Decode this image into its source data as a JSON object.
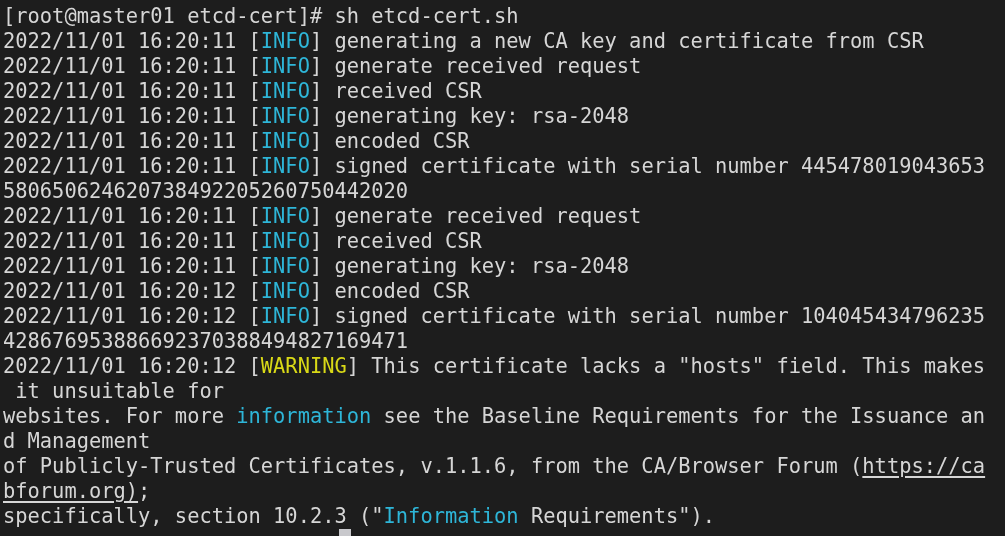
{
  "terminal": {
    "lines": [
      [
        {
          "kind": "text",
          "text": "[root@master01 etcd-cert]# sh etcd-cert.sh"
        }
      ],
      [
        {
          "kind": "text",
          "text": "2022/11/01 16:20:11 ["
        },
        {
          "kind": "info",
          "text": "INFO"
        },
        {
          "kind": "text",
          "text": "] generating a new CA key and certificate from CSR"
        }
      ],
      [
        {
          "kind": "text",
          "text": "2022/11/01 16:20:11 ["
        },
        {
          "kind": "info",
          "text": "INFO"
        },
        {
          "kind": "text",
          "text": "] generate received request"
        }
      ],
      [
        {
          "kind": "text",
          "text": "2022/11/01 16:20:11 ["
        },
        {
          "kind": "info",
          "text": "INFO"
        },
        {
          "kind": "text",
          "text": "] received CSR"
        }
      ],
      [
        {
          "kind": "text",
          "text": "2022/11/01 16:20:11 ["
        },
        {
          "kind": "info",
          "text": "INFO"
        },
        {
          "kind": "text",
          "text": "] generating key: rsa-2048"
        }
      ],
      [
        {
          "kind": "text",
          "text": "2022/11/01 16:20:11 ["
        },
        {
          "kind": "info",
          "text": "INFO"
        },
        {
          "kind": "text",
          "text": "] encoded CSR"
        }
      ],
      [
        {
          "kind": "text",
          "text": "2022/11/01 16:20:11 ["
        },
        {
          "kind": "info",
          "text": "INFO"
        },
        {
          "kind": "text",
          "text": "] signed certificate with serial number 445478019043653"
        }
      ],
      [
        {
          "kind": "text",
          "text": "580650624620738492205260750442020"
        }
      ],
      [
        {
          "kind": "text",
          "text": "2022/11/01 16:20:11 ["
        },
        {
          "kind": "info",
          "text": "INFO"
        },
        {
          "kind": "text",
          "text": "] generate received request"
        }
      ],
      [
        {
          "kind": "text",
          "text": "2022/11/01 16:20:11 ["
        },
        {
          "kind": "info",
          "text": "INFO"
        },
        {
          "kind": "text",
          "text": "] received CSR"
        }
      ],
      [
        {
          "kind": "text",
          "text": "2022/11/01 16:20:11 ["
        },
        {
          "kind": "info",
          "text": "INFO"
        },
        {
          "kind": "text",
          "text": "] generating key: rsa-2048"
        }
      ],
      [
        {
          "kind": "text",
          "text": "2022/11/01 16:20:12 ["
        },
        {
          "kind": "info",
          "text": "INFO"
        },
        {
          "kind": "text",
          "text": "] encoded CSR"
        }
      ],
      [
        {
          "kind": "text",
          "text": "2022/11/01 16:20:12 ["
        },
        {
          "kind": "info",
          "text": "INFO"
        },
        {
          "kind": "text",
          "text": "] signed certificate with serial number 104045434796235"
        }
      ],
      [
        {
          "kind": "text",
          "text": "428676953886692370388494827169471"
        }
      ],
      [
        {
          "kind": "text",
          "text": "2022/11/01 16:20:12 ["
        },
        {
          "kind": "warning",
          "text": "WARNING"
        },
        {
          "kind": "text",
          "text": "] This certificate lacks a \"hosts\" field. This makes"
        }
      ],
      [
        {
          "kind": "text",
          "text": " it unsuitable for"
        }
      ],
      [
        {
          "kind": "text",
          "text": "websites. For more "
        },
        {
          "kind": "info",
          "text": "information"
        },
        {
          "kind": "text",
          "text": " see the Baseline Requirements for the Issuance an"
        }
      ],
      [
        {
          "kind": "text",
          "text": "d Management"
        }
      ],
      [
        {
          "kind": "text",
          "text": "of Publicly-Trusted Certificates, v.1.1.6, from the CA/Browser Forum ("
        },
        {
          "kind": "link",
          "text": "https://ca"
        }
      ],
      [
        {
          "kind": "link",
          "text": "bforum.org)"
        },
        {
          "kind": "text",
          "text": ";"
        }
      ],
      [
        {
          "kind": "text",
          "text": "specifically, section 10.2.3 (\""
        },
        {
          "kind": "info",
          "text": "Information"
        },
        {
          "kind": "text",
          "text": " Requirements\")."
        }
      ]
    ]
  }
}
